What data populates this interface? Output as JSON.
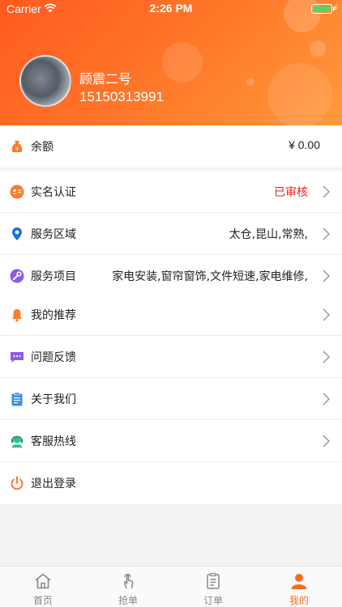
{
  "status_bar": {
    "carrier": "Carrier",
    "time": "2:26 PM"
  },
  "profile": {
    "name": "顾震二号",
    "phone": "15150313991"
  },
  "balance": {
    "label": "余额",
    "value": "¥ 0.00",
    "icon": "money-bag-icon"
  },
  "verify": {
    "label": "实名认证",
    "value": "已审核",
    "icon": "id-card-icon",
    "value_color": "#e8231f"
  },
  "service_area": {
    "label": "服务区域",
    "value": "太仓,昆山,常熟,",
    "icon": "location-pin-icon"
  },
  "service_items": {
    "label": "服务项目",
    "value": "家电安装,窗帘窗饰,文件短速,家电维修,",
    "icon": "wrench-icon"
  },
  "menu": [
    {
      "label": "我的推荐",
      "icon": "bell-icon",
      "color": "#ff7a2a"
    },
    {
      "label": "问题反馈",
      "icon": "feedback-icon",
      "color": "#8a5cf0"
    },
    {
      "label": "关于我们",
      "icon": "clipboard-icon",
      "color": "#3a8ee6"
    },
    {
      "label": "客服热线",
      "icon": "headset-icon",
      "color": "#27c48a"
    },
    {
      "label": "退出登录",
      "icon": "power-icon",
      "color": "#ff7a2a"
    }
  ],
  "tabs": [
    {
      "label": "首页",
      "icon": "home-icon",
      "active": false
    },
    {
      "label": "抢单",
      "icon": "tap-hand-icon",
      "active": false
    },
    {
      "label": "订单",
      "icon": "order-list-icon",
      "active": false
    },
    {
      "label": "我的",
      "icon": "person-icon",
      "active": true
    }
  ],
  "colors": {
    "accent": "#ff6a22",
    "header_start": "#ff5a1f",
    "header_end": "#ff9a3c",
    "highlight_red": "#e8231f"
  }
}
